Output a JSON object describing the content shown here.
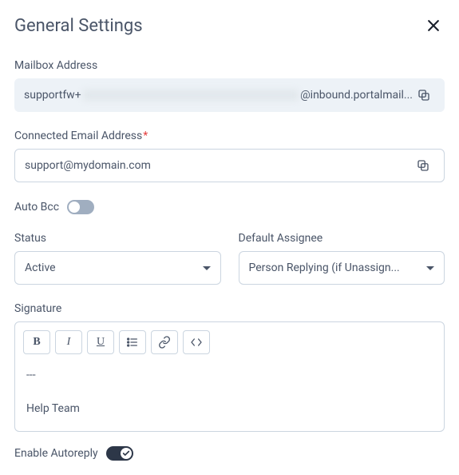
{
  "title": "General Settings",
  "mailbox_address": {
    "label": "Mailbox Address",
    "prefix": "supportfw+",
    "suffix": "@inbound.portalmail..."
  },
  "connected_email": {
    "label": "Connected Email Address",
    "required_mark": "*",
    "value": "support@mydomain.com"
  },
  "auto_bcc": {
    "label": "Auto Bcc",
    "enabled": false
  },
  "status": {
    "label": "Status",
    "value": "Active"
  },
  "default_assignee": {
    "label": "Default Assignee",
    "value": "Person Replying (if Unassign..."
  },
  "signature": {
    "label": "Signature",
    "divider": "---",
    "body": "Help Team"
  },
  "autoreply": {
    "label": "Enable Autoreply",
    "enabled": true
  }
}
